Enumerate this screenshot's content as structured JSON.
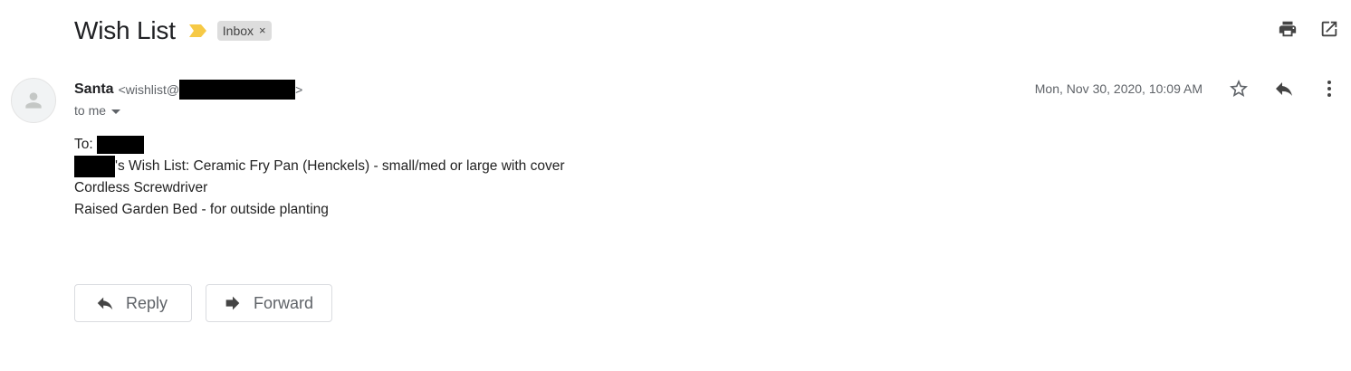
{
  "subject": {
    "title": "Wish List",
    "label": "Inbox",
    "label_remove": "×"
  },
  "toolbar": {
    "print_icon": "print-icon",
    "open_new_window_icon": "open-in-new-window-icon"
  },
  "message": {
    "sender_name": "Santa",
    "sender_email_prefix": "<wishlist@",
    "sender_email_suffix": ">",
    "recipient": "to me",
    "date": "Mon, Nov 30, 2020, 10:09 AM",
    "body": {
      "to_label": "To:",
      "line1": "'s Wish List: Ceramic Fry Pan (Henckels) - small/med or large with cover",
      "line2": "Cordless Screwdriver",
      "line3": "Raised Garden Bed - for outside planting"
    }
  },
  "actions": {
    "reply_label": "Reply",
    "forward_label": "Forward"
  },
  "colors": {
    "important_marker": "#f6c945",
    "label_chip_bg": "#dddddd",
    "redaction": "#000000",
    "secondary_text": "#5f6368"
  }
}
